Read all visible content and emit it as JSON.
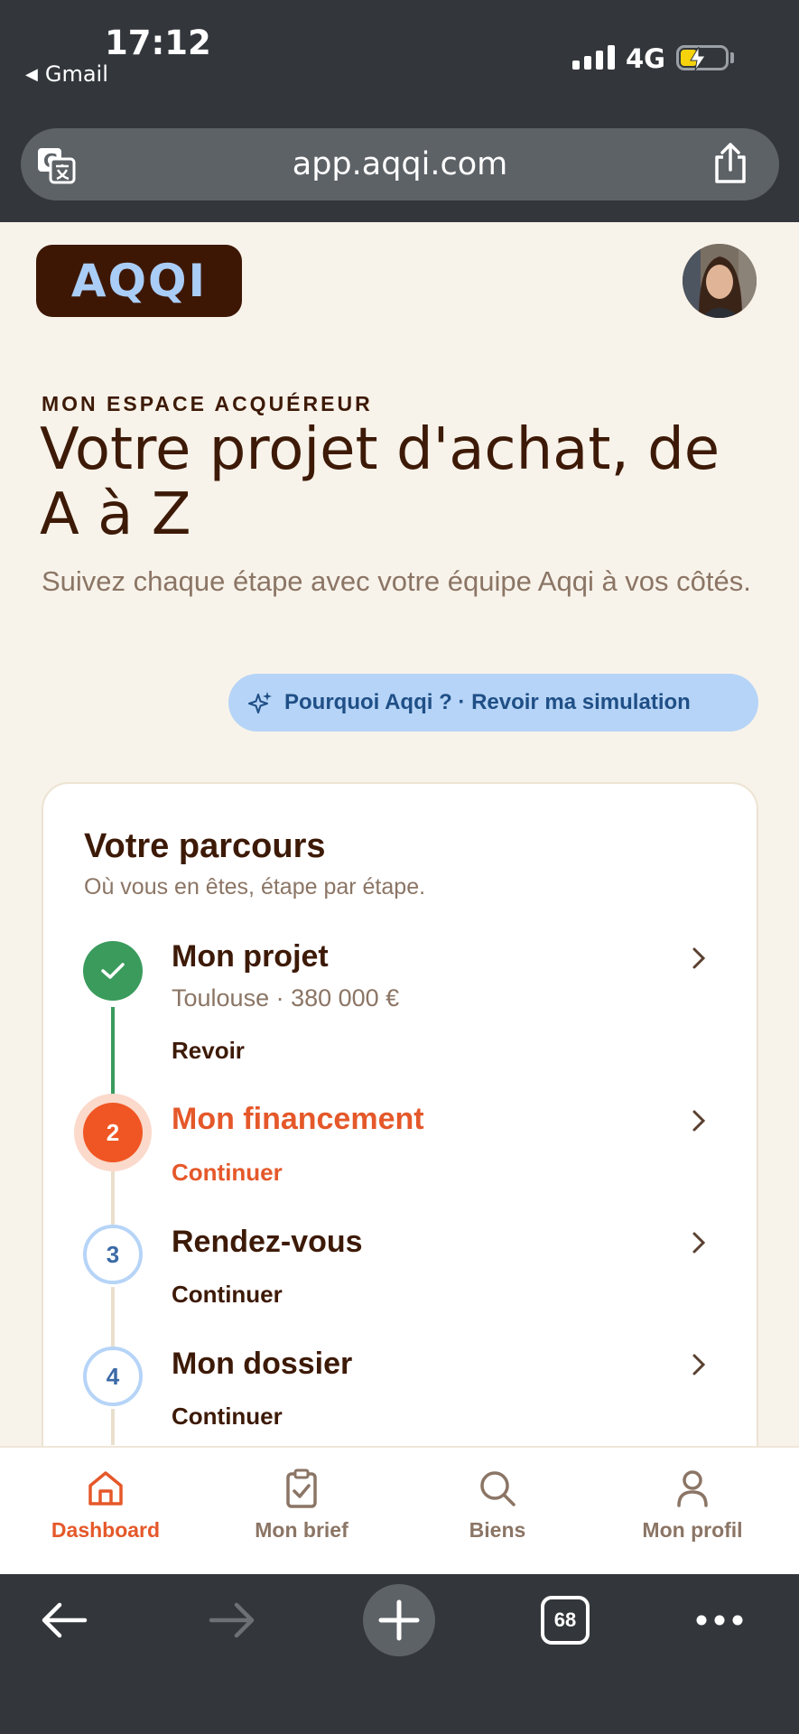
{
  "status_bar": {
    "time": "17:12",
    "back_app": "Gmail",
    "network": "4G"
  },
  "browser": {
    "url": "app.aqqi.com",
    "tabs_count": "68"
  },
  "header": {
    "logo_text": "AQQI"
  },
  "hero": {
    "eyebrow": "MON ESPACE ACQUÉREUR",
    "title": "Votre projet d'achat, de A à Z",
    "subtitle": "Suivez chaque étape avec votre équipe Aqqi à vos côtés.",
    "simulation_button": "Pourquoi Aqqi ? · Revoir ma simulation"
  },
  "journey": {
    "title": "Votre parcours",
    "subtitle": "Où vous en êtes, étape par étape.",
    "steps": [
      {
        "number": "1",
        "title": "Mon projet",
        "meta": "Toulouse · 380 000 €",
        "action": "Revoir",
        "state": "done"
      },
      {
        "number": "2",
        "title": "Mon financement",
        "meta": "",
        "action": "Continuer",
        "state": "current"
      },
      {
        "number": "3",
        "title": "Rendez-vous",
        "meta": "",
        "action": "Continuer",
        "state": "todo"
      },
      {
        "number": "4",
        "title": "Mon dossier",
        "meta": "",
        "action": "Continuer",
        "state": "todo"
      }
    ]
  },
  "bottom_nav": {
    "items": [
      {
        "label": "Dashboard",
        "icon": "home-icon",
        "active": true
      },
      {
        "label": "Mon brief",
        "icon": "clipboard-check-icon",
        "active": false
      },
      {
        "label": "Biens",
        "icon": "search-icon",
        "active": false
      },
      {
        "label": "Mon profil",
        "icon": "user-icon",
        "active": false
      }
    ]
  },
  "colors": {
    "accent": "#e5582a",
    "brown": "#3d1a07",
    "done": "#3a9b5c",
    "todo": "#3b6aa6",
    "page_bg": "#f8f3ea"
  }
}
